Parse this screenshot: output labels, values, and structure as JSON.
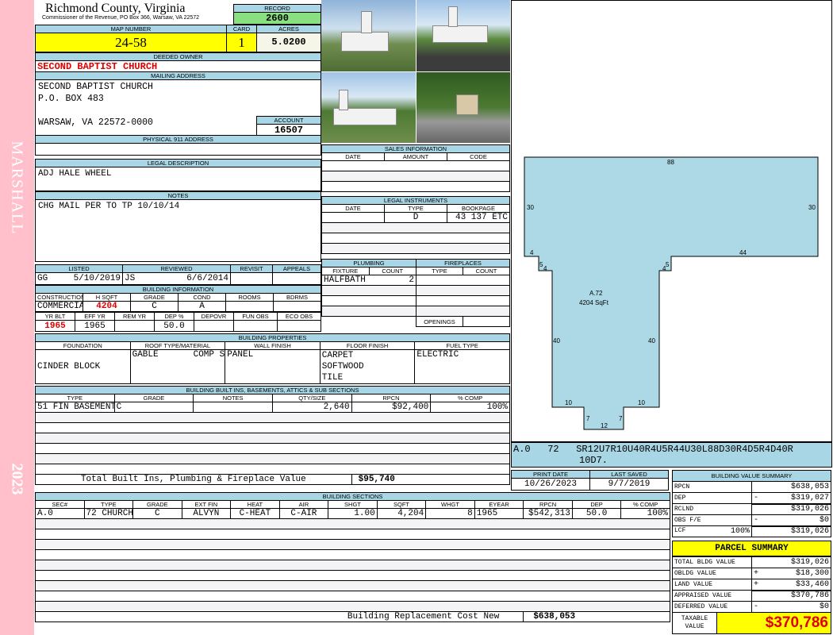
{
  "side": {
    "name": "MARSHALL",
    "year": "2023"
  },
  "header": {
    "title": "Richmond County, Virginia",
    "subtitle": "Commissioner of the Revenue, PO Box 366, Warsaw, VA 22572",
    "record_label": "RECORD",
    "record": "2600"
  },
  "map": {
    "map_label": "MAP NUMBER",
    "map": "24-58",
    "card_label": "CARD",
    "card": "1",
    "acres_label": "ACRES",
    "acres": "5.0200"
  },
  "owner": {
    "label": "DEEDED OWNER",
    "value": "SECOND BAPTIST CHURCH"
  },
  "mailing": {
    "label": "MAILING ADDRESS",
    "line1": "SECOND BAPTIST CHURCH",
    "line2": "P.O. BOX 483",
    "line3": "WARSAW, VA 22572-0000",
    "account_label": "ACCOUNT",
    "account": "16507"
  },
  "physical": {
    "label": "PHYSICAL 911 ADDRESS"
  },
  "legal": {
    "label": "LEGAL DESCRIPTION",
    "value": "ADJ HALE WHEEL"
  },
  "notes": {
    "label": "NOTES",
    "value": "CHG MAIL PER TO TP 10/10/14"
  },
  "listed": {
    "h": [
      "LISTED",
      "REVIEWED",
      "REVISIT",
      "APPEALS"
    ],
    "listed_by": "GG",
    "listed_date": "5/10/2019",
    "reviewed_by": "JS",
    "reviewed_date": "6/6/2014"
  },
  "bldg_info": {
    "label": "BUILDING INFORMATION",
    "h1": [
      "CONSTRUCTION STYLE",
      "H SQFT",
      "GRADE",
      "COND",
      "ROOMS",
      "BDRMS"
    ],
    "v1": [
      "COMMERCIAL",
      "4204",
      "C",
      "A",
      "",
      ""
    ],
    "h2": [
      "YR BLT",
      "EFF YR",
      "REM YR",
      "DEP %",
      "DEPOVR",
      "FUN OBS",
      "ECO OBS"
    ],
    "v2": [
      "1965",
      "1965",
      "",
      "50.0",
      "",
      "",
      ""
    ]
  },
  "sales": {
    "label": "SALES INFORMATION",
    "h": [
      "DATE",
      "AMOUNT",
      "CODE"
    ]
  },
  "instruments": {
    "label": "LEGAL INSTRUMENTS",
    "h": [
      "DATE",
      "TYPE",
      "BOOKPAGE"
    ],
    "row": [
      "",
      "D",
      "43 137 ETC"
    ]
  },
  "plumbing": {
    "label": "PLUMBING",
    "h": [
      "FIXTURE",
      "COUNT"
    ],
    "row": [
      "HALFBATH",
      "2"
    ]
  },
  "fireplaces": {
    "label": "FIREPLACES",
    "h": [
      "TYPE",
      "COUNT"
    ],
    "openings": "OPENINGS"
  },
  "props": {
    "label": "BUILDING PROPERTIES",
    "h": [
      "FOUNDATION",
      "ROOF TYPE/MATERIAL",
      "WALL FINISH",
      "FLOOR FINISH",
      "FUEL TYPE"
    ],
    "foundation": "CINDER BLOCK",
    "roof_type": "GABLE",
    "roof_mat": "COMP SHGLS",
    "wall": "PANEL",
    "floor1": "CARPET",
    "floor2": "SOFTWOOD",
    "floor3": "TILE",
    "fuel": "ELECTRIC"
  },
  "builtins": {
    "label": "BUILDING BUILT INS, BASEMENTS, ATTICS & SUB SECTIONS",
    "h": [
      "TYPE",
      "GRADE",
      "NOTES",
      "QTY/SIZE",
      "RPCN",
      "% COMP"
    ],
    "row": [
      "51 FIN BASEMENT",
      "C",
      "",
      "2,640",
      "$92,400",
      "100%"
    ],
    "total_label": "Total Built Ins, Plumbing & Fireplace Value",
    "total": "$95,740"
  },
  "sections": {
    "label": "BUILDING SECTIONS",
    "h": [
      "SEC#",
      "TYPE",
      "GRADE",
      "EXT FIN",
      "HEAT",
      "AIR",
      "SHGT",
      "SQFT",
      "WHGT",
      "EYEAR",
      "RPCN",
      "DEP",
      "% COMP"
    ],
    "row": [
      "A.0",
      "72 CHURCH",
      "C",
      "ALVYN",
      "C-HEAT",
      "C-AIR",
      "1.00",
      "4,204",
      "8",
      "1965",
      "$542,313",
      "50.0",
      "100%"
    ],
    "rcn_label": "Building Replacement Cost New",
    "rcn": "$638,053"
  },
  "sketch": {
    "dims": {
      "top": "88",
      "left": "30",
      "right": "30",
      "l4": "4",
      "r44": "44",
      "n5a": "5",
      "n4a": "4",
      "n4b": "4",
      "n5b": "5",
      "l40": "40",
      "r40": "40",
      "b10a": "10",
      "b10b": "10",
      "b7a": "7",
      "b7b": "7",
      "b12": "12"
    },
    "area_label": "A.72",
    "area_sqft": "4204 SqFt",
    "sec": "A.0",
    "code": "72",
    "vector": "SR12U7R10U40R4U5R44U30L88D30R4D5R4D40R",
    "vector2": "10D7."
  },
  "dates": {
    "print_label": "PRINT DATE",
    "print": "10/26/2023",
    "saved_label": "LAST SAVED",
    "saved": "9/7/2019"
  },
  "bvs": {
    "label": "BUILDING VALUE SUMMARY",
    "rows": [
      {
        "k": "RPCN",
        "s": "",
        "v": "$638,053"
      },
      {
        "k": "DEP",
        "s": "-",
        "v": "$319,027"
      },
      {
        "k": "RCLND",
        "s": "",
        "v": "$319,026"
      },
      {
        "k": "OBS F/E",
        "s": "-",
        "v": "$0"
      },
      {
        "k": "LCF",
        "p": "100%",
        "s": "",
        "v": "$319,026"
      }
    ]
  },
  "parcel": {
    "label": "PARCEL SUMMARY",
    "rows": [
      {
        "k": "TOTAL BLDG VALUE",
        "s": "",
        "v": "$319,026"
      },
      {
        "k": "OBLDG VALUE",
        "s": "+",
        "v": "$18,300"
      },
      {
        "k": "LAND VALUE",
        "s": "+",
        "v": "$33,460"
      },
      {
        "k": "APPRAISED VALUE",
        "s": "",
        "v": "$370,786"
      },
      {
        "k": "DEFERRED VALUE",
        "s": "-",
        "v": "$0"
      }
    ],
    "taxable_label1": "TAXABLE",
    "taxable_label2": "VALUE",
    "taxable": "$370,786"
  },
  "colors": {
    "label_bg": "#a9d6e5",
    "yellow": "#ffff00",
    "green": "#88e080",
    "pink": "#ffc0cb",
    "sketch": "#add8e6",
    "red": "#e00000"
  }
}
